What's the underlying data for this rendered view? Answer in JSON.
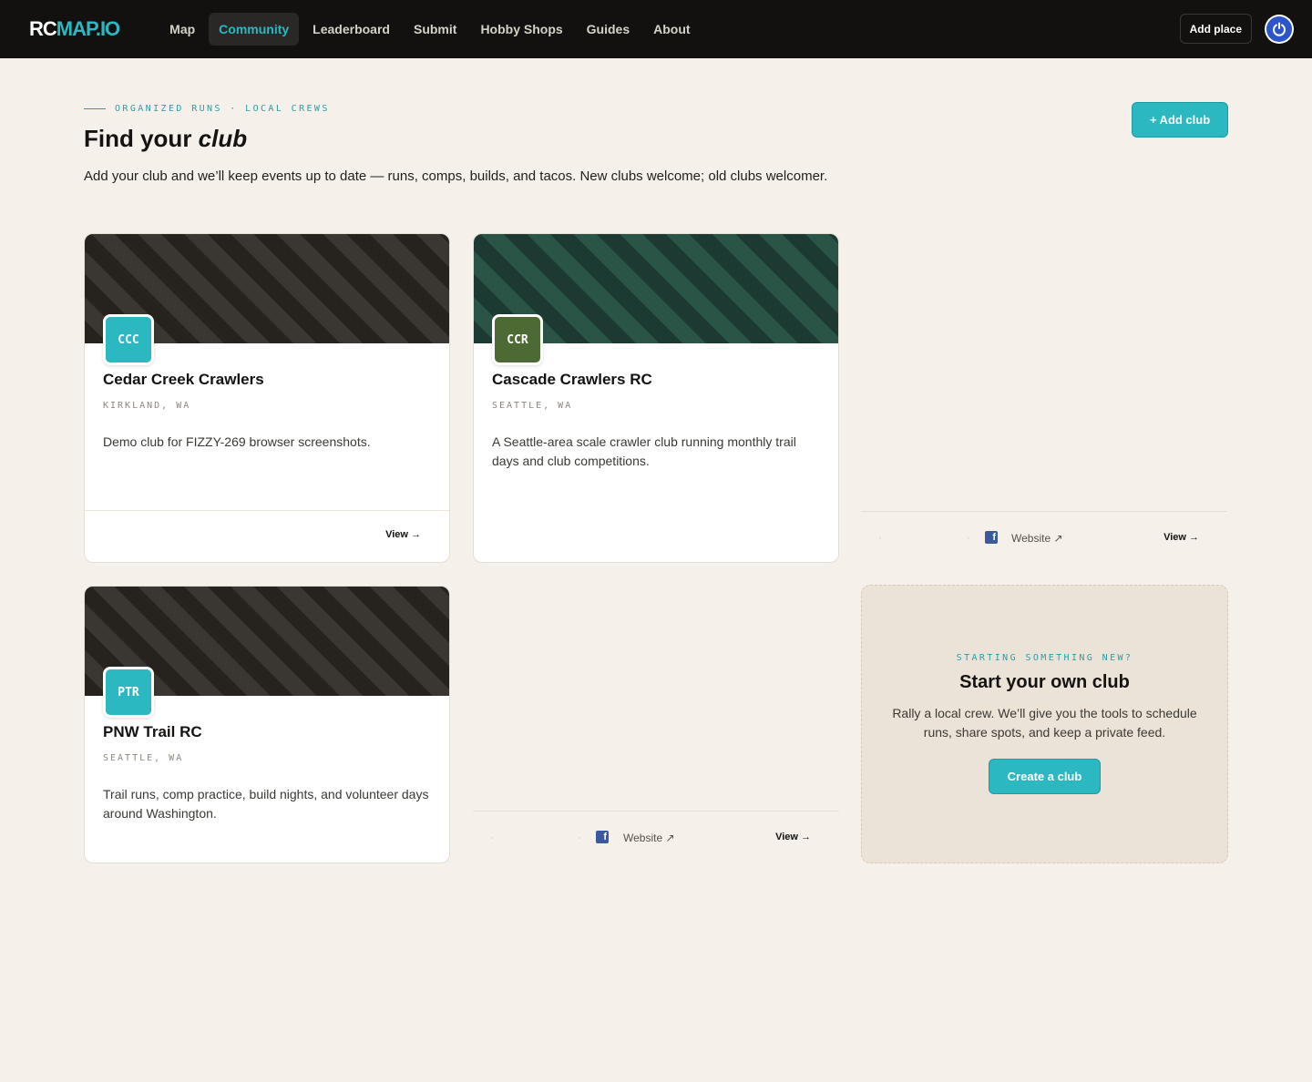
{
  "nav": {
    "logo_part1": "RC",
    "logo_part2": "MAP.IO",
    "links": [
      "Map",
      "Community",
      "Leaderboard",
      "Submit",
      "Hobby Shops",
      "Guides",
      "About"
    ],
    "add_place": "Add place"
  },
  "header": {
    "eyebrow": "ORGANIZED RUNS · LOCAL CREWS",
    "title_prefix": "Find your ",
    "title_emphasis": "club",
    "intro": "Add your club and we’ll keep events up to date — runs, comps, builds, and tacos. New clubs welcome; old clubs welcomer.",
    "add_club": "+ Add club"
  },
  "clubs": [
    {
      "badge": "CCC",
      "name": "Cedar Creek Crawlers",
      "location": "KIRKLAND, WA",
      "description": "Demo club for FIZZY-269 browser screenshots.",
      "view": "View →"
    },
    {
      "badge": "CCR",
      "name": "Cascade Crawlers RC",
      "location": "SEATTLE, WA",
      "description": "A Seattle-area scale crawler club running monthly trail days and club competitions."
    },
    {
      "badge": "PTR",
      "name": "PNW Trail RC",
      "location": "SEATTLE, WA",
      "description": "Trail runs, comp practice, build nights, and volunteer days around Washington."
    }
  ],
  "loose_footers": [
    {
      "fb": "f",
      "website": "Website ↗",
      "view": "View →"
    },
    {
      "fb": "f",
      "website": "Website ↗",
      "view": "View →"
    }
  ],
  "cta": {
    "eyebrow": "STARTING SOMETHING NEW?",
    "title": "Start your own club",
    "text": "Rally a local crew. We’ll give you the tools to schedule runs, share spots, and keep a private feed.",
    "button": "Create a club"
  },
  "colors": {
    "accent": "#2bb8c0",
    "navbar": "#121110",
    "page_bg": "#f5f1ea",
    "badge_olive": "#4d6a35"
  }
}
